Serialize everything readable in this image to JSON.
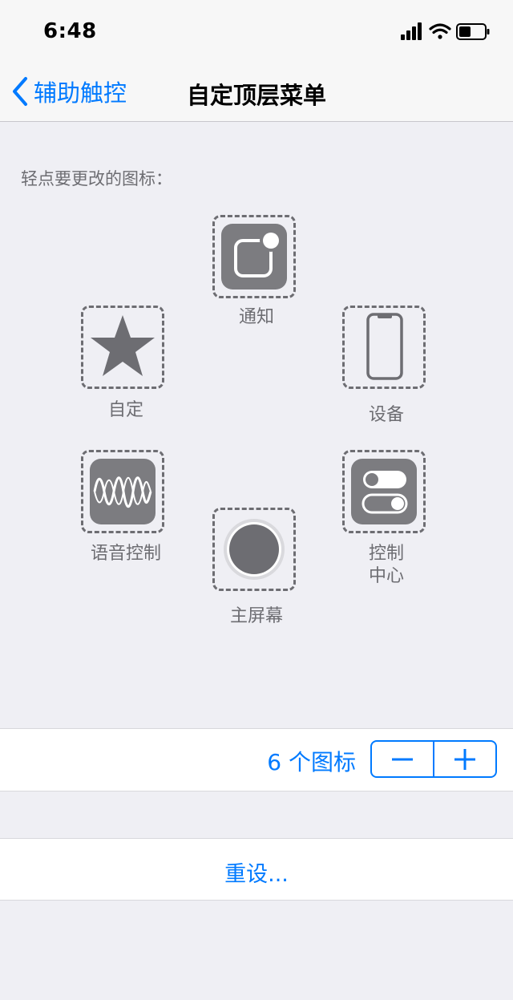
{
  "status_bar": {
    "time": "6:48"
  },
  "nav": {
    "back_label": "辅助触控",
    "title": "自定顶层菜单"
  },
  "instruction": "轻点要更改的图标：",
  "icons": {
    "notification": {
      "label": "通知",
      "icon": "notification-icon"
    },
    "custom": {
      "label": "自定",
      "icon": "star-icon"
    },
    "device": {
      "label": "设备",
      "icon": "phone-icon"
    },
    "voice_control": {
      "label": "语音控制",
      "icon": "waveform-icon"
    },
    "control_center": {
      "label_line1": "控制",
      "label_line2": "中心",
      "icon": "toggles-icon"
    },
    "home": {
      "label": "主屏幕",
      "icon": "home-button-icon"
    }
  },
  "counter": {
    "label": "6 个图标",
    "minus": "−",
    "plus": "+"
  },
  "reset": {
    "label": "重设..."
  },
  "colors": {
    "accent": "#007aff",
    "icon_gray": "#7c7c80",
    "background": "#efeff4"
  }
}
